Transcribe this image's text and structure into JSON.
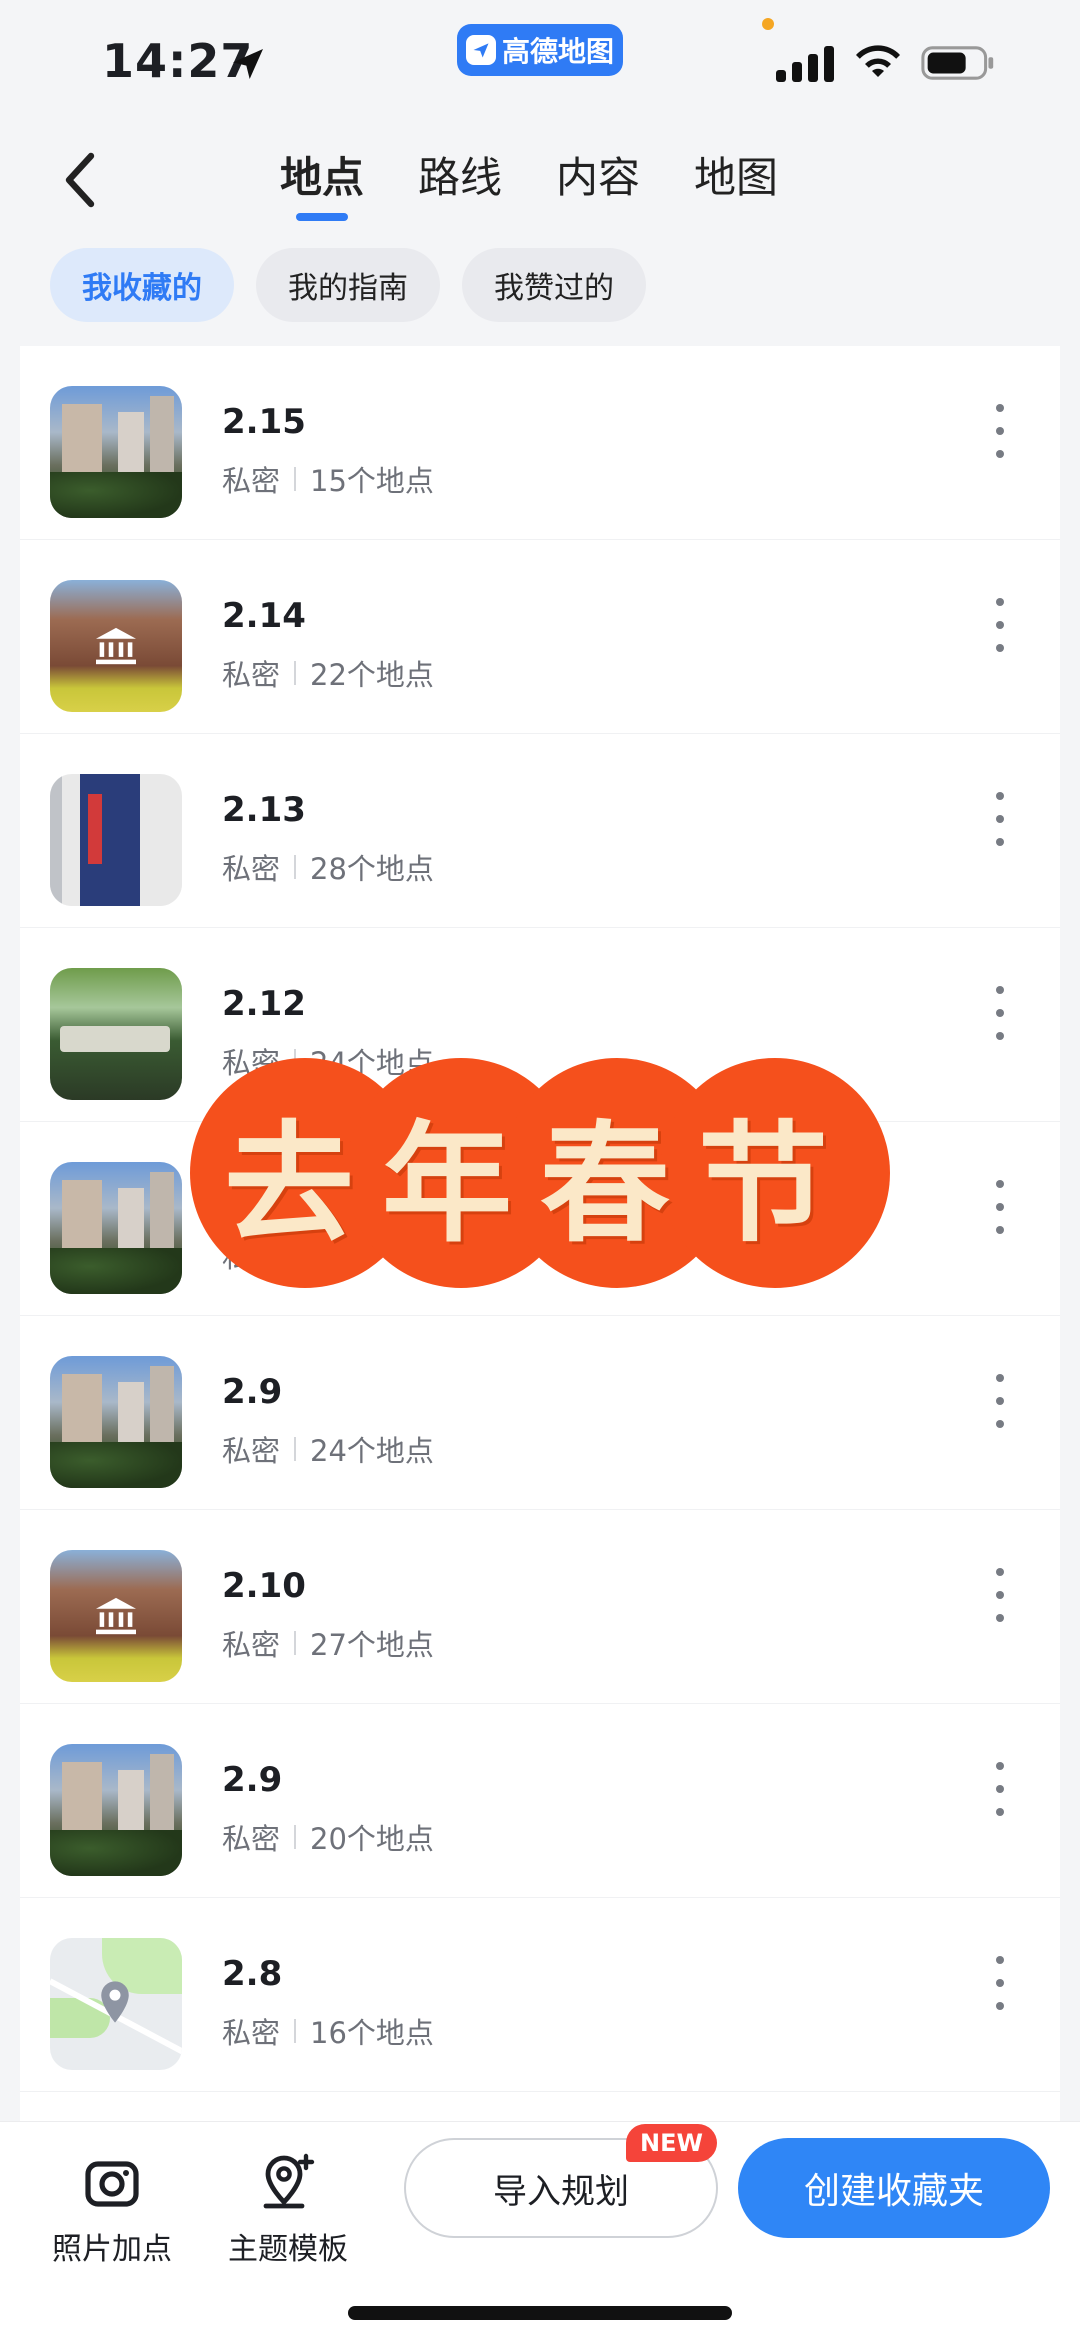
{
  "status_bar": {
    "time": "14:27",
    "app_pill_label": "高德地图"
  },
  "nav": {
    "tabs": [
      {
        "label": "地点",
        "active": true
      },
      {
        "label": "路线",
        "active": false
      },
      {
        "label": "内容",
        "active": false
      },
      {
        "label": "地图",
        "active": false
      }
    ]
  },
  "filters": [
    {
      "label": "我收藏的",
      "active": true
    },
    {
      "label": "我的指南",
      "active": false
    },
    {
      "label": "我赞过的",
      "active": false
    }
  ],
  "list": {
    "items": [
      {
        "title": "2.15",
        "privacy": "私密",
        "count": "15个地点",
        "thumb": "building"
      },
      {
        "title": "2.14",
        "privacy": "私密",
        "count": "22个地点",
        "thumb": "museum"
      },
      {
        "title": "2.13",
        "privacy": "私密",
        "count": "28个地点",
        "thumb": "shop"
      },
      {
        "title": "2.12",
        "privacy": "私密",
        "count": "24个地点",
        "thumb": "park"
      },
      {
        "title": "",
        "privacy": "私",
        "count": "",
        "thumb": "building"
      },
      {
        "title": "2.9",
        "privacy": "私密",
        "count": "24个地点",
        "thumb": "building"
      },
      {
        "title": "2.10",
        "privacy": "私密",
        "count": "27个地点",
        "thumb": "museum"
      },
      {
        "title": "2.9",
        "privacy": "私密",
        "count": "20个地点",
        "thumb": "building"
      },
      {
        "title": "2.8",
        "privacy": "私密",
        "count": "16个地点",
        "thumb": "map"
      }
    ]
  },
  "sticker": {
    "text": "去年春节"
  },
  "bottom_bar": {
    "photo_label": "照片加点",
    "theme_label": "主题模板",
    "import_label": "导入规划",
    "new_badge": "NEW",
    "create_label": "创建收藏夹"
  },
  "colors": {
    "accent": "#2f7bf5",
    "sticker": "#f5501c",
    "badge": "#f5443a"
  }
}
